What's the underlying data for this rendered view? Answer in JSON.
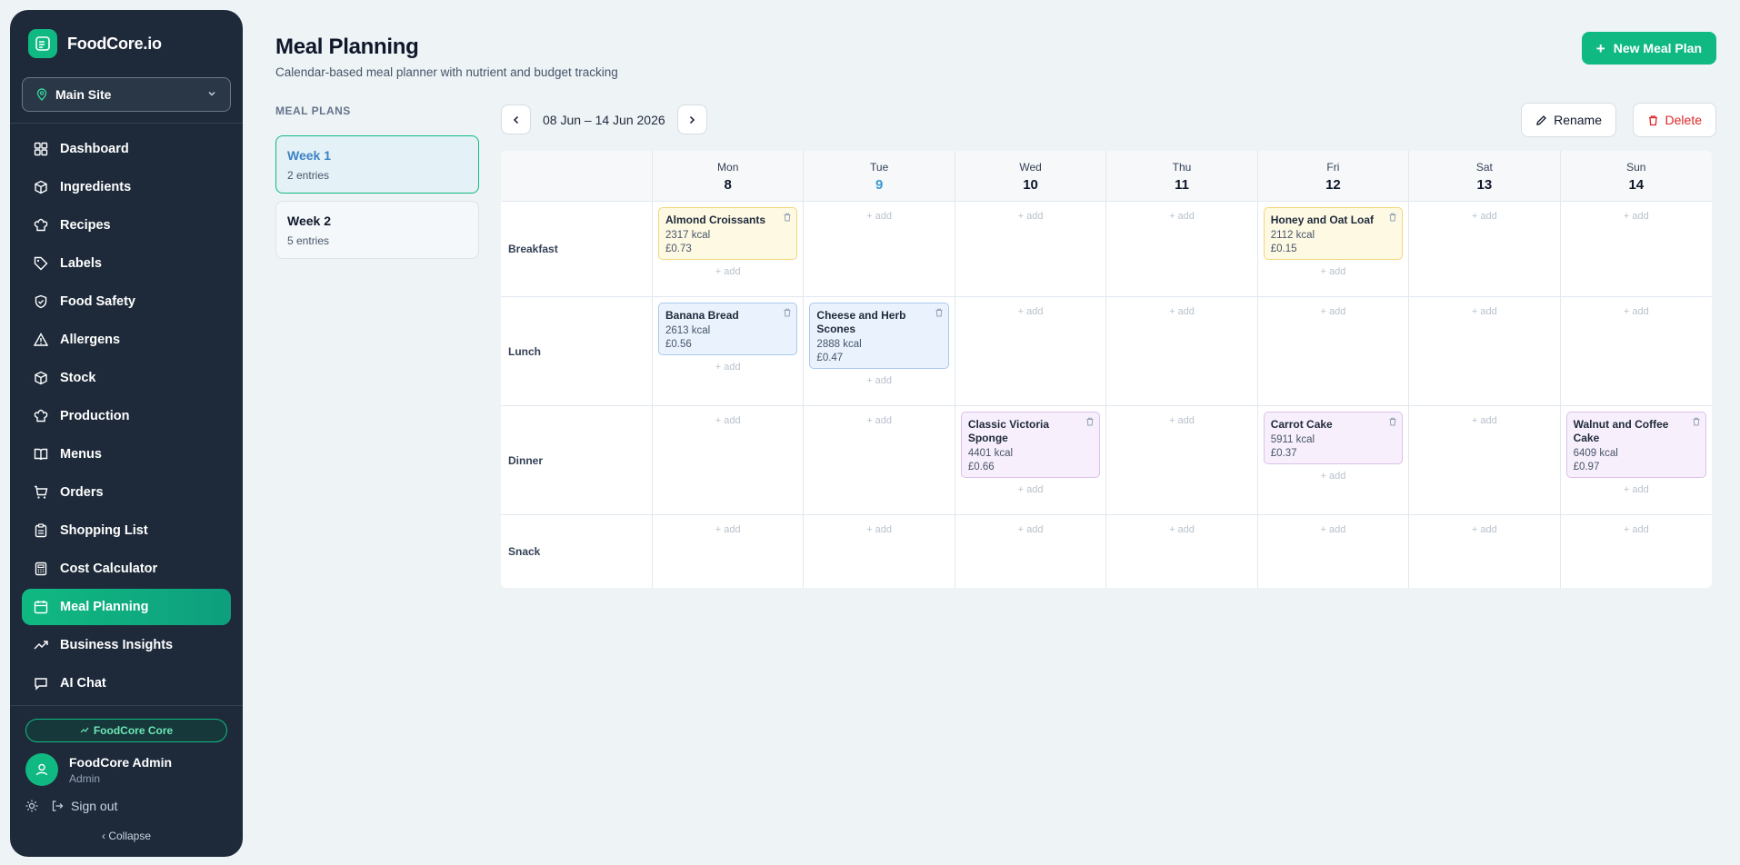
{
  "app": {
    "brand": "FoodCore.io",
    "site": "Main Site",
    "nav": [
      {
        "label": "Dashboard",
        "icon": "grid-icon"
      },
      {
        "label": "Ingredients",
        "icon": "box-icon"
      },
      {
        "label": "Recipes",
        "icon": "chef-hat-icon"
      },
      {
        "label": "Labels",
        "icon": "tag-icon"
      },
      {
        "label": "Food Safety",
        "icon": "shield-icon"
      },
      {
        "label": "Allergens",
        "icon": "warning-icon"
      },
      {
        "label": "Stock",
        "icon": "package-icon"
      },
      {
        "label": "Production",
        "icon": "chef-hat-icon"
      },
      {
        "label": "Menus",
        "icon": "book-icon"
      },
      {
        "label": "Orders",
        "icon": "cart-icon"
      },
      {
        "label": "Shopping List",
        "icon": "clipboard-icon"
      },
      {
        "label": "Cost Calculator",
        "icon": "calculator-icon"
      },
      {
        "label": "Meal Planning",
        "icon": "calendar-icon",
        "active": true
      },
      {
        "label": "Business Insights",
        "icon": "trend-icon"
      },
      {
        "label": "AI Chat",
        "icon": "chat-icon"
      }
    ],
    "plan_badge": "FoodCore Core",
    "user": {
      "name": "FoodCore Admin",
      "role": "Admin"
    },
    "signout": "Sign out",
    "collapse": "Collapse"
  },
  "page": {
    "title": "Meal Planning",
    "subtitle": "Calendar-based meal planner with nutrient and budget tracking",
    "new_button": "New Meal Plan",
    "plans_heading": "MEAL PLANS",
    "plans": [
      {
        "name": "Week 1",
        "count": "2 entries",
        "active": true
      },
      {
        "name": "Week 2",
        "count": "5 entries",
        "active": false
      }
    ],
    "week_range": "08 Jun – 14 Jun 2026",
    "rename": "Rename",
    "delete": "Delete",
    "add_label": "+ add"
  },
  "calendar": {
    "days": [
      {
        "name": "Mon",
        "num": "8"
      },
      {
        "name": "Tue",
        "num": "9",
        "today": true
      },
      {
        "name": "Wed",
        "num": "10"
      },
      {
        "name": "Thu",
        "num": "11"
      },
      {
        "name": "Fri",
        "num": "12"
      },
      {
        "name": "Sat",
        "num": "13"
      },
      {
        "name": "Sun",
        "num": "14"
      }
    ],
    "rows": [
      {
        "label": "Breakfast",
        "type": "breakfast",
        "cells": [
          {
            "name": "Almond Croissants",
            "kcal": "2317 kcal",
            "cost": "£0.73"
          },
          null,
          null,
          null,
          {
            "name": "Honey and Oat Loaf",
            "kcal": "2112 kcal",
            "cost": "£0.15"
          },
          null,
          null
        ]
      },
      {
        "label": "Lunch",
        "type": "lunch",
        "cells": [
          {
            "name": "Banana Bread",
            "kcal": "2613 kcal",
            "cost": "£0.56"
          },
          {
            "name": "Cheese and Herb Scones",
            "kcal": "2888 kcal",
            "cost": "£0.47"
          },
          null,
          null,
          null,
          null,
          null
        ]
      },
      {
        "label": "Dinner",
        "type": "dinner",
        "cells": [
          null,
          null,
          {
            "name": "Classic Victoria Sponge",
            "kcal": "4401 kcal",
            "cost": "£0.66"
          },
          null,
          {
            "name": "Carrot Cake",
            "kcal": "5911 kcal",
            "cost": "£0.37"
          },
          null,
          {
            "name": "Walnut and Coffee Cake",
            "kcal": "6409 kcal",
            "cost": "£0.97"
          }
        ]
      },
      {
        "label": "Snack",
        "type": "snack",
        "cells": [
          null,
          null,
          null,
          null,
          null,
          null,
          null
        ]
      }
    ]
  },
  "colors": {
    "accent": "#10b981",
    "sidebar": "#1e2a3a",
    "today": "#3b9bd1",
    "danger": "#dc2626"
  }
}
